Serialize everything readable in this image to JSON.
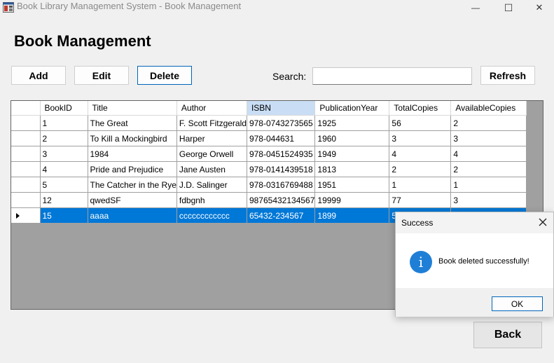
{
  "window": {
    "title": "Book Library Management System - Book Management",
    "minimize_glyph": "—",
    "maximize_glyph": "☐",
    "close_glyph": "✕"
  },
  "page": {
    "heading": "Book Management"
  },
  "toolbar": {
    "add_label": "Add",
    "edit_label": "Edit",
    "delete_label": "Delete",
    "search_label": "Search:",
    "search_value": "",
    "refresh_label": "Refresh"
  },
  "grid": {
    "columns": [
      "BookID",
      "Title",
      "Author",
      "ISBN",
      "PublicationYear",
      "TotalCopies",
      "AvailableCopies"
    ],
    "sorted_column": "ISBN",
    "rows": [
      [
        "1",
        "The Great",
        "F. Scott Fitzgerald",
        "978-0743273565",
        "1925",
        "56",
        "2"
      ],
      [
        "2",
        "To Kill a Mockingbird",
        "Harper",
        "978-044631",
        "1960",
        "3",
        "3"
      ],
      [
        "3",
        "1984",
        "George Orwell",
        "978-0451524935",
        "1949",
        "4",
        "4"
      ],
      [
        "4",
        "Pride and Prejudice",
        "Jane Austen",
        "978-0141439518",
        "1813",
        "2",
        "2"
      ],
      [
        "5",
        "The Catcher in the Rye",
        "J.D. Salinger",
        "978-0316769488",
        "1951",
        "1",
        "1"
      ],
      [
        "12",
        "qwedSF",
        "fdbgnh",
        "98765432134567",
        "19999",
        "77",
        "3"
      ],
      [
        "15",
        "aaaa",
        "cccccccccccc",
        "65432-234567",
        "1899",
        "54",
        ""
      ]
    ],
    "selected_row_index": 6
  },
  "dialog": {
    "title": "Success",
    "message": "Book deleted successfully!",
    "ok_label": "OK",
    "icon": "info-icon",
    "icon_glyph": "i"
  },
  "footer": {
    "back_label": "Back"
  },
  "colors": {
    "selection": "#0078d7",
    "sorted_header": "#c9def5",
    "grid_background": "#a0a0a0",
    "info_icon": "#1f7fd6"
  }
}
